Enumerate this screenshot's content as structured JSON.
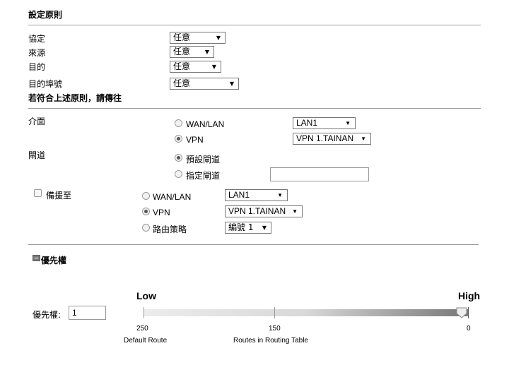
{
  "sections": {
    "rule_title": "設定原則",
    "match_title": "若符合上述原則，請傳往",
    "priority_title": "優先權"
  },
  "rule": {
    "protocol": {
      "label": "協定",
      "value": "任意"
    },
    "source": {
      "label": "來源",
      "value": "任意"
    },
    "destination": {
      "label": "目的",
      "value": "任意"
    },
    "dest_port": {
      "label": "目的埠號",
      "value": "任意"
    }
  },
  "interface": {
    "label": "介面",
    "options": [
      {
        "label": "WAN/LAN",
        "selected": false,
        "select_value": "LAN1"
      },
      {
        "label": "VPN",
        "selected": true,
        "select_value": "VPN 1.TAINAN"
      }
    ]
  },
  "gateway": {
    "label": "閘道",
    "options": [
      {
        "label": "預設閘道",
        "selected": true
      },
      {
        "label": "指定閘道",
        "selected": false,
        "input_value": ""
      }
    ]
  },
  "failover": {
    "label": "備援至",
    "checked": false,
    "options": [
      {
        "label": "WAN/LAN",
        "selected": false,
        "select_value": "LAN1"
      },
      {
        "label": "VPN",
        "selected": true,
        "select_value": "VPN 1.TAINAN"
      },
      {
        "label": "路由策略",
        "selected": false,
        "select_value": "編號 1"
      }
    ]
  },
  "priority": {
    "label": "優先權:",
    "value": "1",
    "low_label": "Low",
    "high_label": "High",
    "ticks": [
      "250",
      "150",
      "0"
    ],
    "captions": [
      "Default Route",
      "Routes in Routing Table"
    ],
    "slider_value": 1
  },
  "icons": {
    "collapse": "minus-box-icon",
    "caret": "triangle-down-icon"
  }
}
